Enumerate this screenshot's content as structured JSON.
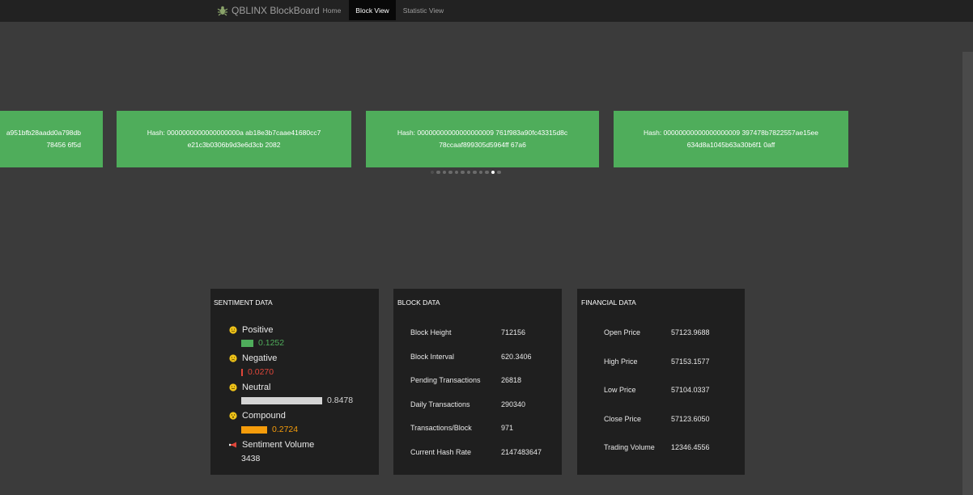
{
  "nav": {
    "brand": "QBLINX BlockBoard",
    "links": [
      {
        "label": "Home",
        "active": false
      },
      {
        "label": "Block View",
        "active": true
      },
      {
        "label": "Statistic View",
        "active": false
      }
    ]
  },
  "carousel": {
    "cards": [
      {
        "line1": "a951bfb28aadd0a798db",
        "line2": "78456 6f5d"
      },
      {
        "line1": "Hash: 0000000000000000000a ab18e3b7caae41680cc7",
        "line2": "e21c3b0306b9d3e6d3cb 2082"
      },
      {
        "line1": "Hash: 00000000000000000009 761f983a90fc43315d8c",
        "line2": "78ccaaf899305d5964ff 67a6"
      },
      {
        "line1": "Hash: 00000000000000000009 397478b7822557ae15ee",
        "line2": "634d8a1045b63a30b6f1 0aff"
      }
    ],
    "dot_count": 12,
    "active_dot": 10,
    "card_color": "#4fad5b"
  },
  "sentiment": {
    "title": "SENTIMENT DATA",
    "positive": {
      "label": "Positive",
      "value": "0.1252",
      "color": "#4fad5b"
    },
    "negative": {
      "label": "Negative",
      "value": "0.0270",
      "color": "#e0463a"
    },
    "neutral": {
      "label": "Neutral",
      "value": "0.8478",
      "color": "#d4d4d4"
    },
    "compound": {
      "label": "Compound",
      "value": "0.2724",
      "color": "#f59c0b"
    },
    "volume": {
      "label": "Sentiment Volume",
      "value": "3438"
    }
  },
  "block": {
    "title": "BLOCK DATA",
    "rows": [
      {
        "label": "Block Height",
        "value": "712156"
      },
      {
        "label": "Block Interval",
        "value": "620.3406"
      },
      {
        "label": "Pending Transactions",
        "value": "26818"
      },
      {
        "label": "Daily Transactions",
        "value": "290340"
      },
      {
        "label": "Transactions/Block",
        "value": "971"
      },
      {
        "label": "Current Hash Rate",
        "value": "2147483647"
      }
    ]
  },
  "financial": {
    "title": "FINANCIAL DATA",
    "rows": [
      {
        "label": "Open Price",
        "value": "57123.9688"
      },
      {
        "label": "High Price",
        "value": "57153.1577"
      },
      {
        "label": "Low Price",
        "value": "57104.0337"
      },
      {
        "label": "Close Price",
        "value": "57123.6050"
      },
      {
        "label": "Trading Volume",
        "value": "12346.4556"
      }
    ]
  }
}
